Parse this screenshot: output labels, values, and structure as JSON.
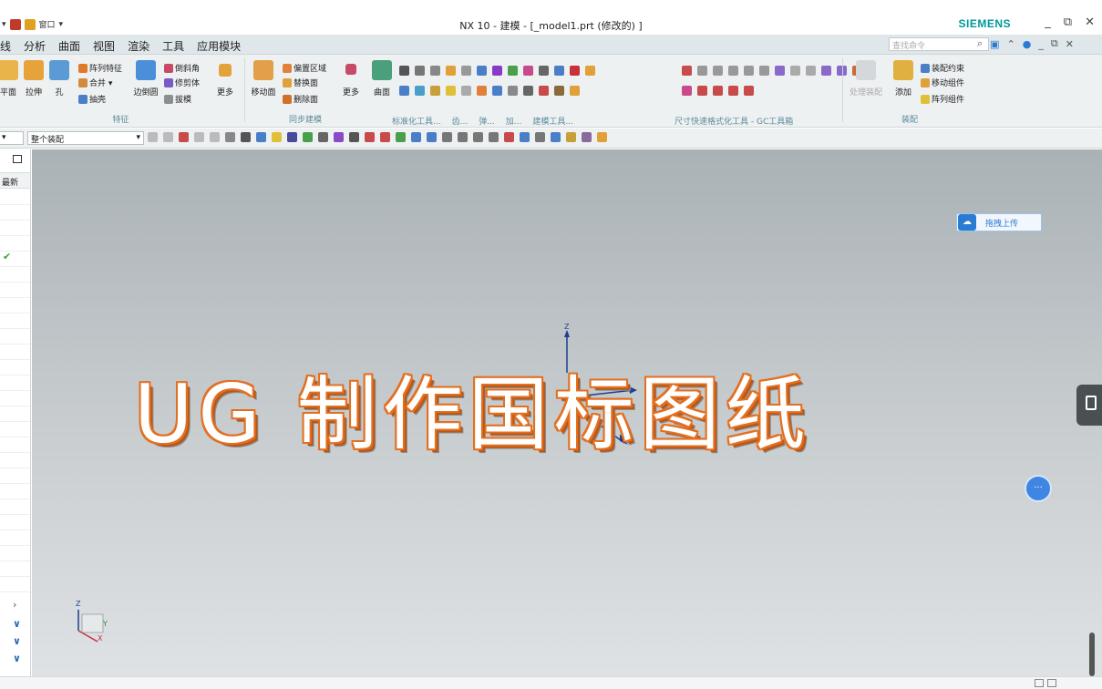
{
  "window": {
    "title": "NX 10 - 建模 - [_model1.prt  (修改的) ]",
    "brand": "SIEMENS",
    "quick_access": "窗口",
    "minimize": "_",
    "restore": "⧉",
    "close": "✕"
  },
  "menu": {
    "items": [
      "线",
      "分析",
      "曲面",
      "视图",
      "渲染",
      "工具",
      "应用模块"
    ],
    "search_placeholder": "查找命令"
  },
  "ribbon": {
    "feature_group": {
      "label": "特征",
      "big": [
        "平面",
        "拉伸",
        "孔",
        "边倒圆",
        "更多"
      ],
      "small": [
        "阵列特征",
        "合并 ▾",
        "抽壳",
        "倒斜角",
        "修剪体",
        "拔模"
      ]
    },
    "sync_group": {
      "label": "同步建模",
      "big": [
        "移动面",
        "更多"
      ],
      "small": [
        "偏置区域",
        "替换面",
        "删除面"
      ]
    },
    "surface_big": "曲面",
    "std_label": "标准化工具...",
    "gear_label": "齿...",
    "spring_label": "弹...",
    "add_label": "加...",
    "build_label": "建模工具...",
    "dim_label": "尺寸快速格式化工具 - GC工具箱",
    "assembly_group": {
      "label": "装配",
      "big": [
        "处理装配",
        "添加"
      ],
      "small": [
        "装配约束",
        "移动组件",
        "阵列组件"
      ]
    }
  },
  "toolbar": {
    "filter_value": "",
    "assembly_scope": "整个装配"
  },
  "navigator": {
    "column_header": "最新"
  },
  "viewport": {
    "overlay_text": "UG 制作国标图纸",
    "upload_label": "拖拽上传",
    "axis_z": "Z",
    "axis_x": "X",
    "axis_y": "Y"
  }
}
